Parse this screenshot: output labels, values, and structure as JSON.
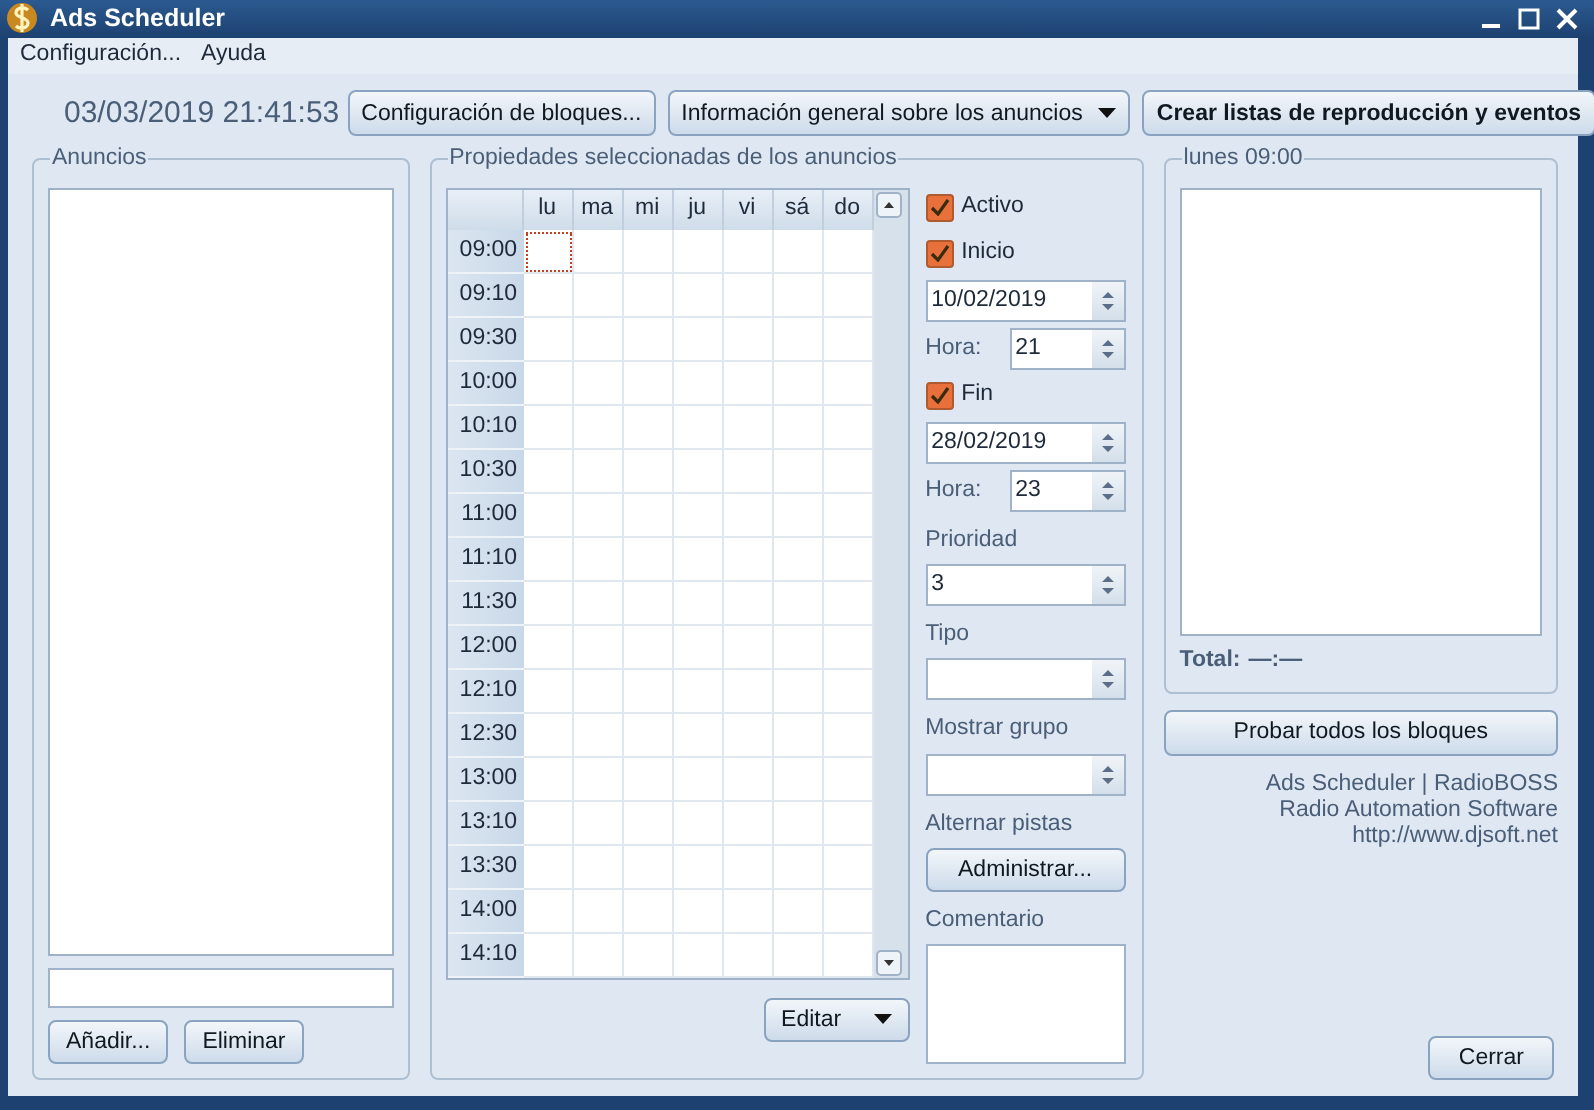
{
  "window": {
    "title": "Ads Scheduler"
  },
  "menu": [
    {
      "label": "Configuración..."
    },
    {
      "label": "Ayuda"
    }
  ],
  "clock": "03/03/2019 21:41:53",
  "toolbar": [
    {
      "kind": "plain",
      "label": "Configuración de bloques..."
    },
    {
      "kind": "dropdown",
      "label": "Información general sobre los anuncios"
    },
    {
      "kind": "bold",
      "label": "Crear listas de reproducción y eventos"
    }
  ],
  "ads_panel": {
    "title": "Anuncios",
    "buttons": [
      "Añadir...",
      "Eliminar"
    ]
  },
  "properties": {
    "title": "Propiedades seleccionadas de los anuncios",
    "days": [
      "lu",
      "ma",
      "mi",
      "ju",
      "vi",
      "sá",
      "do"
    ],
    "rows": [
      {
        "time": "09:00",
        "focused": true
      },
      {
        "time": "09:10",
        "focused": false
      },
      {
        "time": "09:30",
        "focused": false
      },
      {
        "time": "10:00",
        "focused": false
      },
      {
        "time": "10:10",
        "focused": false
      },
      {
        "time": "10:30",
        "focused": false
      },
      {
        "time": "11:00",
        "focused": false
      },
      {
        "time": "11:10",
        "focused": false
      },
      {
        "time": "11:30",
        "focused": false
      },
      {
        "time": "12:00",
        "focused": false
      },
      {
        "time": "12:10",
        "focused": false
      },
      {
        "time": "12:30",
        "focused": false
      },
      {
        "time": "13:00",
        "focused": false
      },
      {
        "time": "13:10",
        "focused": false
      },
      {
        "time": "13:30",
        "focused": false
      },
      {
        "time": "14:00",
        "focused": false
      },
      {
        "time": "14:10",
        "focused": false
      }
    ],
    "edit_button": "Editar",
    "side": [
      {
        "kind": "checkbox",
        "label": "Activo",
        "checked": true
      },
      {
        "kind": "checkbox",
        "label": "Inicio",
        "checked": true
      },
      {
        "kind": "spin",
        "value": "10/02/2019"
      },
      {
        "kind": "hour",
        "label": "Hora:",
        "value": "21"
      },
      {
        "kind": "checkbox",
        "label": "Fin",
        "checked": true
      },
      {
        "kind": "spin",
        "value": "28/02/2019"
      },
      {
        "kind": "hour",
        "label": "Hora:",
        "value": "23"
      },
      {
        "kind": "caption",
        "label": "Prioridad"
      },
      {
        "kind": "spin",
        "value": "3"
      },
      {
        "kind": "caption",
        "label": "Tipo"
      },
      {
        "kind": "spin"
      },
      {
        "kind": "caption",
        "label": "Mostrar grupo"
      },
      {
        "kind": "spin"
      },
      {
        "kind": "caption",
        "label": "Alternar pistas"
      },
      {
        "kind": "button",
        "label": "Administrar..."
      },
      {
        "kind": "caption",
        "label": "Comentario"
      },
      {
        "kind": "memo"
      }
    ]
  },
  "preview": {
    "title": "lunes 09:00",
    "total_label": "Total:",
    "total_value": "—:—",
    "test_button": "Probar todos los bloques",
    "credits": [
      "Ads Scheduler | RadioBOSS",
      "Radio Automation Software",
      "http://www.djsoft.net"
    ],
    "close_button": "Cerrar"
  }
}
